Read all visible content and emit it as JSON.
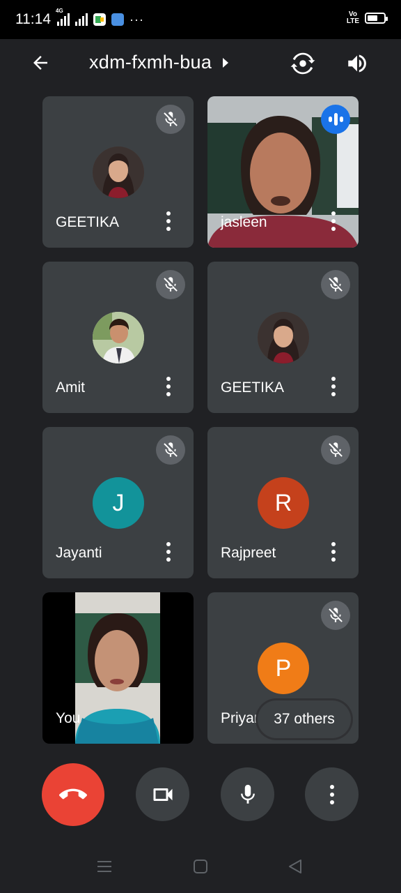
{
  "status_bar": {
    "time": "11:14",
    "network_label": "4G",
    "volte_top": "Vo",
    "volte_bottom": "LTE",
    "overflow": "···",
    "battery_fraction": 0.7
  },
  "header": {
    "meeting_code": "xdm-fxmh-bua",
    "icons": [
      "back-arrow-icon",
      "chevron-right-icon",
      "switch-camera-icon",
      "speaker-icon"
    ]
  },
  "participants": [
    {
      "name": "GEETIKA",
      "avatar_type": "photo",
      "muted": true,
      "avatar_color": "#5a4a44"
    },
    {
      "name": "jasleen",
      "avatar_type": "video",
      "muted": false,
      "speaking": true
    },
    {
      "name": "Amit",
      "avatar_type": "photo",
      "muted": true,
      "avatar_color": "#c8d8b0"
    },
    {
      "name": "GEETIKA",
      "avatar_type": "photo",
      "muted": true,
      "avatar_color": "#5a4a44"
    },
    {
      "name": "Jayanti",
      "avatar_type": "initial",
      "initial": "J",
      "muted": true,
      "avatar_color": "#12939a"
    },
    {
      "name": "Rajpreet",
      "avatar_type": "initial",
      "initial": "R",
      "muted": true,
      "avatar_color": "#c5411c"
    },
    {
      "name": "You",
      "avatar_type": "video",
      "muted": false
    },
    {
      "name": "Priyan",
      "avatar_type": "initial",
      "initial": "P",
      "muted": true,
      "avatar_color": "#f07c17"
    }
  ],
  "others_chip": "37 others",
  "controls": {
    "icons": [
      "end-call-icon",
      "video-camera-icon",
      "microphone-icon",
      "more-options-icon"
    ],
    "end_call_color": "#ea4335"
  },
  "nav_bar": {
    "icons": [
      "recent-apps-icon",
      "home-icon",
      "back-icon"
    ]
  },
  "colors": {
    "background": "#202124",
    "tile": "#3c4043",
    "mute_badge": "#5f6368",
    "speaking_badge": "#1a73e8"
  }
}
